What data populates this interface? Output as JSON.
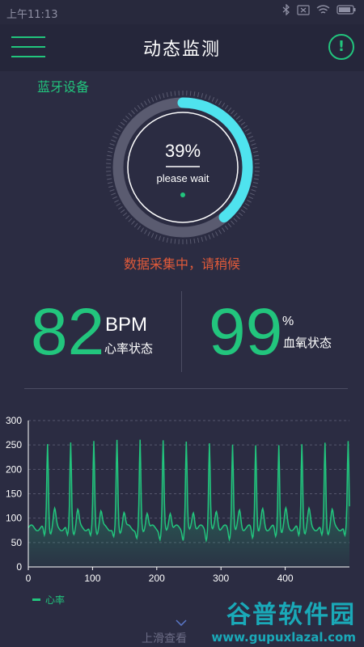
{
  "status_bar": {
    "time": "上午11:13"
  },
  "app_bar": {
    "title": "动态监测"
  },
  "bluetooth_label": "蓝牙设备",
  "gauge": {
    "percent_text": "39%",
    "progress": 0.39,
    "subtitle": "please wait"
  },
  "status_message": "数据采集中，请稍候",
  "metrics": {
    "heart_rate": {
      "value": "82",
      "unit": "BPM",
      "label": "心率状态"
    },
    "spo2": {
      "value": "99",
      "unit": "%",
      "label": "血氧状态"
    }
  },
  "colors": {
    "accent": "#22c57d",
    "gauge_progress": "#4fe3ee",
    "warning": "#e05a3a",
    "background": "#2b2c42"
  },
  "chart_data": {
    "type": "line",
    "ylim": [
      0,
      300
    ],
    "xlim": [
      0,
      500
    ],
    "yticks": [
      0,
      50,
      100,
      150,
      200,
      250,
      300
    ],
    "xticks": [
      0,
      100,
      200,
      300,
      400
    ],
    "grid": true,
    "legend_position": "bottom-left",
    "series": [
      {
        "name": "心率",
        "peaks_x": [
          30,
          66,
          102,
          138,
          174,
          210,
          246,
          282,
          318,
          354,
          390,
          426,
          462,
          498
        ],
        "peak_value": 255,
        "baseline": 80
      }
    ]
  },
  "swipe_hint": "上滑查看",
  "watermark": {
    "title": "谷普软件园",
    "url": "www.gupuxlazal.com"
  }
}
